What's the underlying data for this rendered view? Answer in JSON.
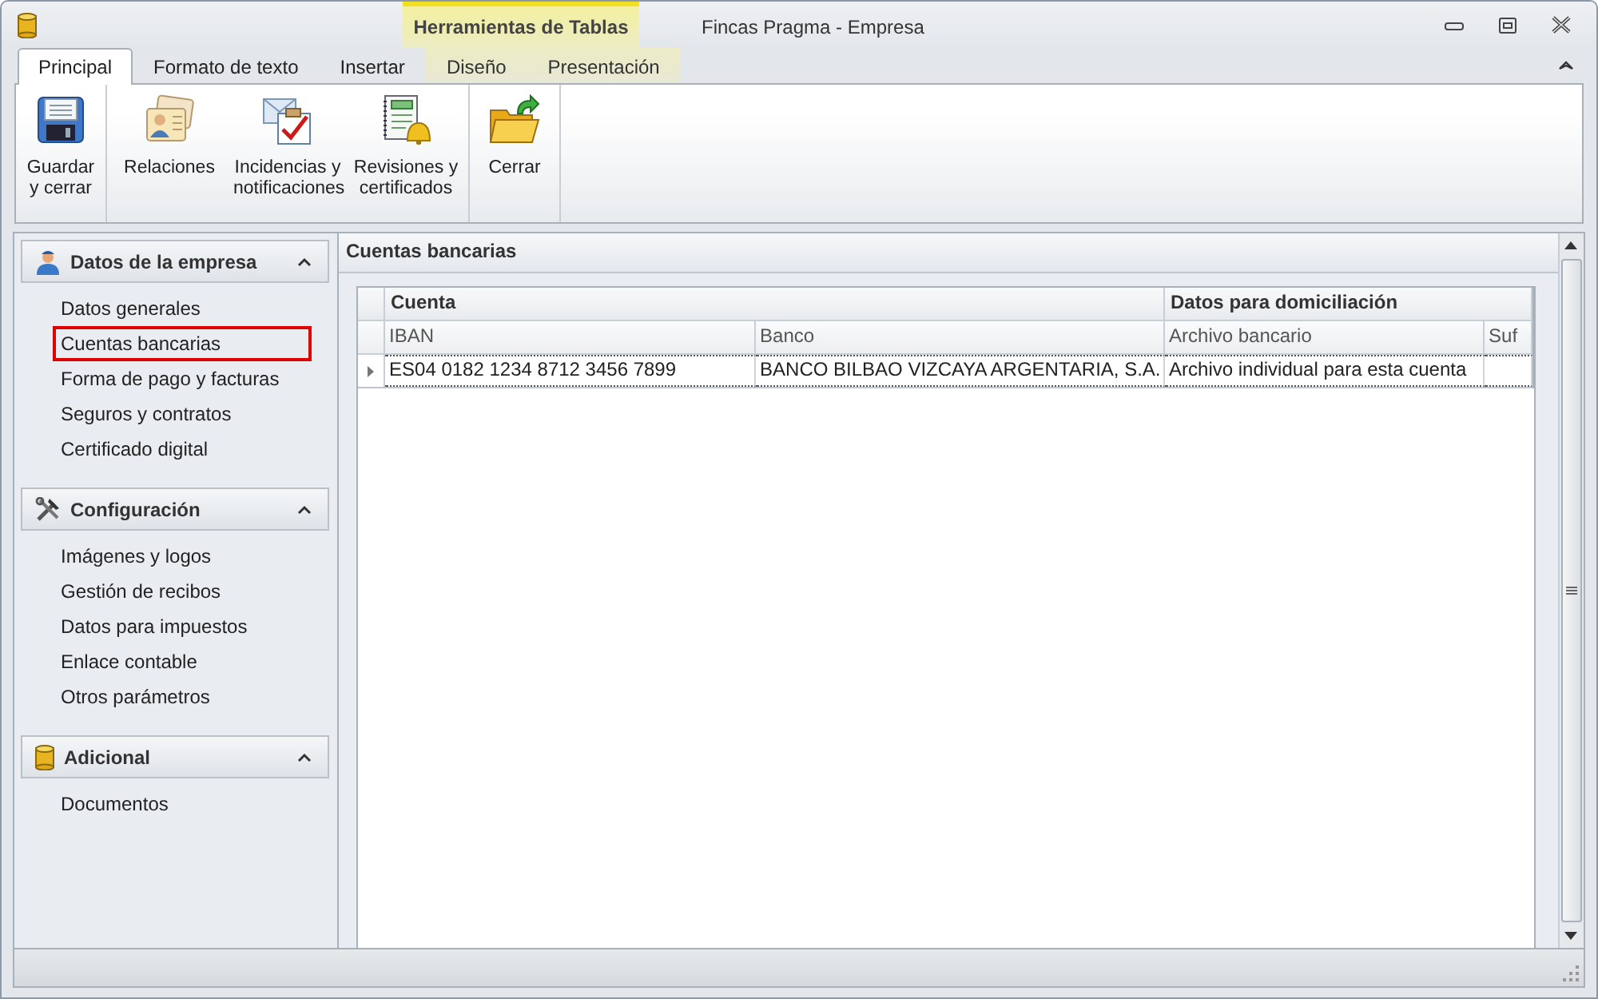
{
  "window": {
    "title": "Fincas Pragma - Empresa"
  },
  "contextual_group": {
    "label": "Herramientas de Tablas"
  },
  "tabs": [
    {
      "label": "Principal",
      "selected": true,
      "kind": "normal"
    },
    {
      "label": "Formato de texto",
      "selected": false,
      "kind": "normal"
    },
    {
      "label": "Insertar",
      "selected": false,
      "kind": "normal"
    },
    {
      "label": "Diseño",
      "selected": false,
      "kind": "contextual"
    },
    {
      "label": "Presentación",
      "selected": false,
      "kind": "contextual"
    }
  ],
  "ribbon": {
    "groups": [
      {
        "buttons": [
          {
            "label": "Guardar y cerrar",
            "kind": "save"
          }
        ]
      },
      {
        "buttons": [
          {
            "label": "Relaciones",
            "kind": "cards"
          },
          {
            "label": "Incidencias y notificaciones",
            "kind": "mail"
          },
          {
            "label": "Revisiones y certificados",
            "kind": "bell"
          }
        ]
      },
      {
        "buttons": [
          {
            "label": "Cerrar",
            "kind": "folder"
          }
        ]
      }
    ]
  },
  "sidebar": {
    "sections": [
      {
        "title": "Datos de la empresa",
        "kind": "person",
        "expanded": true,
        "items": [
          {
            "label": "Datos generales",
            "outlined": false
          },
          {
            "label": "Cuentas bancarias",
            "outlined": true
          },
          {
            "label": "Forma de pago y facturas",
            "outlined": false
          },
          {
            "label": "Seguros y contratos",
            "outlined": false
          },
          {
            "label": "Certificado digital",
            "outlined": false
          }
        ]
      },
      {
        "title": "Configuración",
        "kind": "tools",
        "expanded": true,
        "items": [
          {
            "label": "Imágenes y logos",
            "outlined": false
          },
          {
            "label": "Gestión de recibos",
            "outlined": false
          },
          {
            "label": "Datos para impuestos",
            "outlined": false
          },
          {
            "label": "Enlace contable",
            "outlined": false
          },
          {
            "label": "Otros parámetros",
            "outlined": false
          }
        ]
      },
      {
        "title": "Adicional",
        "kind": "cylinder",
        "expanded": true,
        "items": [
          {
            "label": "Documentos",
            "outlined": false
          }
        ]
      }
    ]
  },
  "panel": {
    "title": "Cuentas bancarias"
  },
  "table": {
    "bands": [
      {
        "label": "Cuenta"
      },
      {
        "label": "Datos para domiciliación"
      }
    ],
    "columns": [
      "IBAN",
      "Banco",
      "Archivo bancario",
      "Suf"
    ],
    "rows": [
      {
        "current": true,
        "cells": [
          "ES04 0182 1234 8712 3456 7899",
          "BANCO BILBAO VIZCAYA ARGENTARIA, S.A.",
          "Archivo individual para esta cuenta"
        ]
      }
    ]
  }
}
